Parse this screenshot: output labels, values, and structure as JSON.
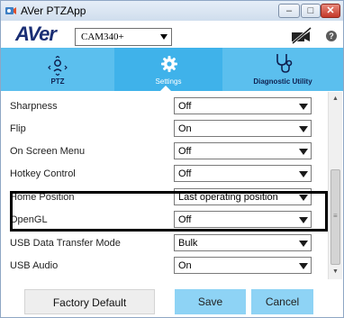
{
  "window": {
    "title": "AVer PTZApp"
  },
  "titlebar": {
    "min": "–",
    "max": "□",
    "close": "✕"
  },
  "header": {
    "logo": "AVer",
    "camera": "CAM340+",
    "help": "?"
  },
  "tabs": [
    {
      "label": "PTZ",
      "icon": "ptz-icon"
    },
    {
      "label": "Settings",
      "icon": "gear-icon"
    },
    {
      "label": "Diagnostic Utility",
      "icon": "stethoscope-icon"
    }
  ],
  "settings": [
    {
      "name": "Sharpness",
      "value": "Off"
    },
    {
      "name": "Flip",
      "value": "On"
    },
    {
      "name": "On Screen Menu",
      "value": "Off"
    },
    {
      "name": "Hotkey Control",
      "value": "Off"
    },
    {
      "name": "Home Position",
      "value": "Last operating position"
    },
    {
      "name": "OpenGL",
      "value": "Off"
    },
    {
      "name": "USB Data Transfer Mode",
      "value": "Bulk"
    },
    {
      "name": "USB Audio",
      "value": "On"
    }
  ],
  "scrollbar": {
    "up": "▲",
    "down": "▼",
    "grip": "≡"
  },
  "footer": {
    "factory": "Factory Default",
    "save": "Save",
    "cancel": "Cancel"
  },
  "colors": {
    "tabbar": "#5bbfee",
    "button": "#8ed3f5",
    "brand": "#1a2e74"
  }
}
